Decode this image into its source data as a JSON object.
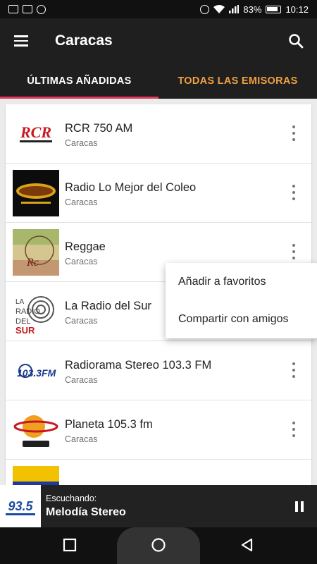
{
  "status_bar": {
    "battery": "83%",
    "time": "10:12"
  },
  "app_bar": {
    "title": "Caracas"
  },
  "tabs": [
    {
      "label": "ÚLTIMAS AÑADIDAS",
      "active": true
    },
    {
      "label": "TODAS LAS EMISORAS",
      "active": false
    }
  ],
  "stations": [
    {
      "name": "RCR 750 AM",
      "city": "Caracas",
      "logo_text": "RCR"
    },
    {
      "name": "Radio Lo Mejor del Coleo",
      "city": "Caracas",
      "logo_text": ""
    },
    {
      "name": "Reggae",
      "city": "Caracas",
      "logo_text": "Rc"
    },
    {
      "name": "La Radio del Sur",
      "city": "Caracas",
      "logo_text": "LA RADIO DEL SUR"
    },
    {
      "name": "Radiorama Stereo 103.3 FM",
      "city": "Caracas",
      "logo_text": "103.3FM"
    },
    {
      "name": "Planeta 105.3 fm",
      "city": "Caracas",
      "logo_text": ""
    },
    {
      "name": "",
      "city": "",
      "logo_text": ""
    }
  ],
  "popup_menu": {
    "items": [
      "Añadir a favoritos",
      "Compartir con amigos"
    ]
  },
  "player": {
    "label": "Escuchando:",
    "title": "Melodía Stereo",
    "logo_text": "93.5"
  },
  "colors": {
    "app_bar": "#1f1f1f",
    "tab_indicator": "#e33a5a",
    "tab_inactive": "#f0a040",
    "player_bg": "#222222"
  }
}
